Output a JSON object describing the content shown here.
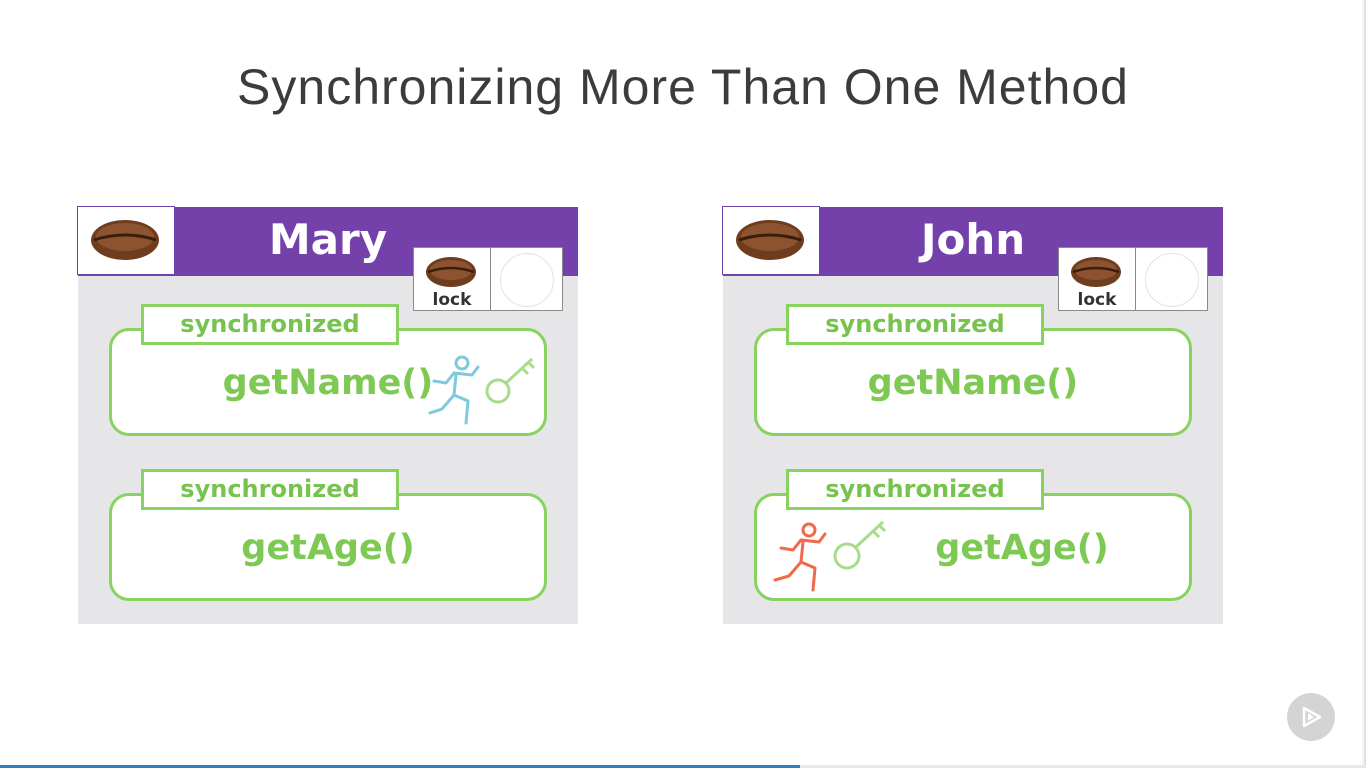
{
  "title": "Synchronizing More Than One Method",
  "objects": [
    {
      "name": "Mary",
      "lock_label": "lock",
      "methods": [
        {
          "modifier": "synchronized",
          "name": "getName()"
        },
        {
          "modifier": "synchronized",
          "name": "getAge()"
        }
      ]
    },
    {
      "name": "John",
      "lock_label": "lock",
      "methods": [
        {
          "modifier": "synchronized",
          "name": "getName()"
        },
        {
          "modifier": "synchronized",
          "name": "getAge()"
        }
      ]
    }
  ],
  "colors": {
    "header": "#7441ab",
    "method_border": "#88d260",
    "method_text": "#7dc954",
    "thread_blue": "#7ec8e0",
    "thread_red": "#f06a4a",
    "key": "#a8dc8a",
    "panel": "#e6e5e8"
  },
  "icons": [
    "coffee-bean-icon",
    "running-thread-icon",
    "key-icon",
    "play-icon"
  ]
}
